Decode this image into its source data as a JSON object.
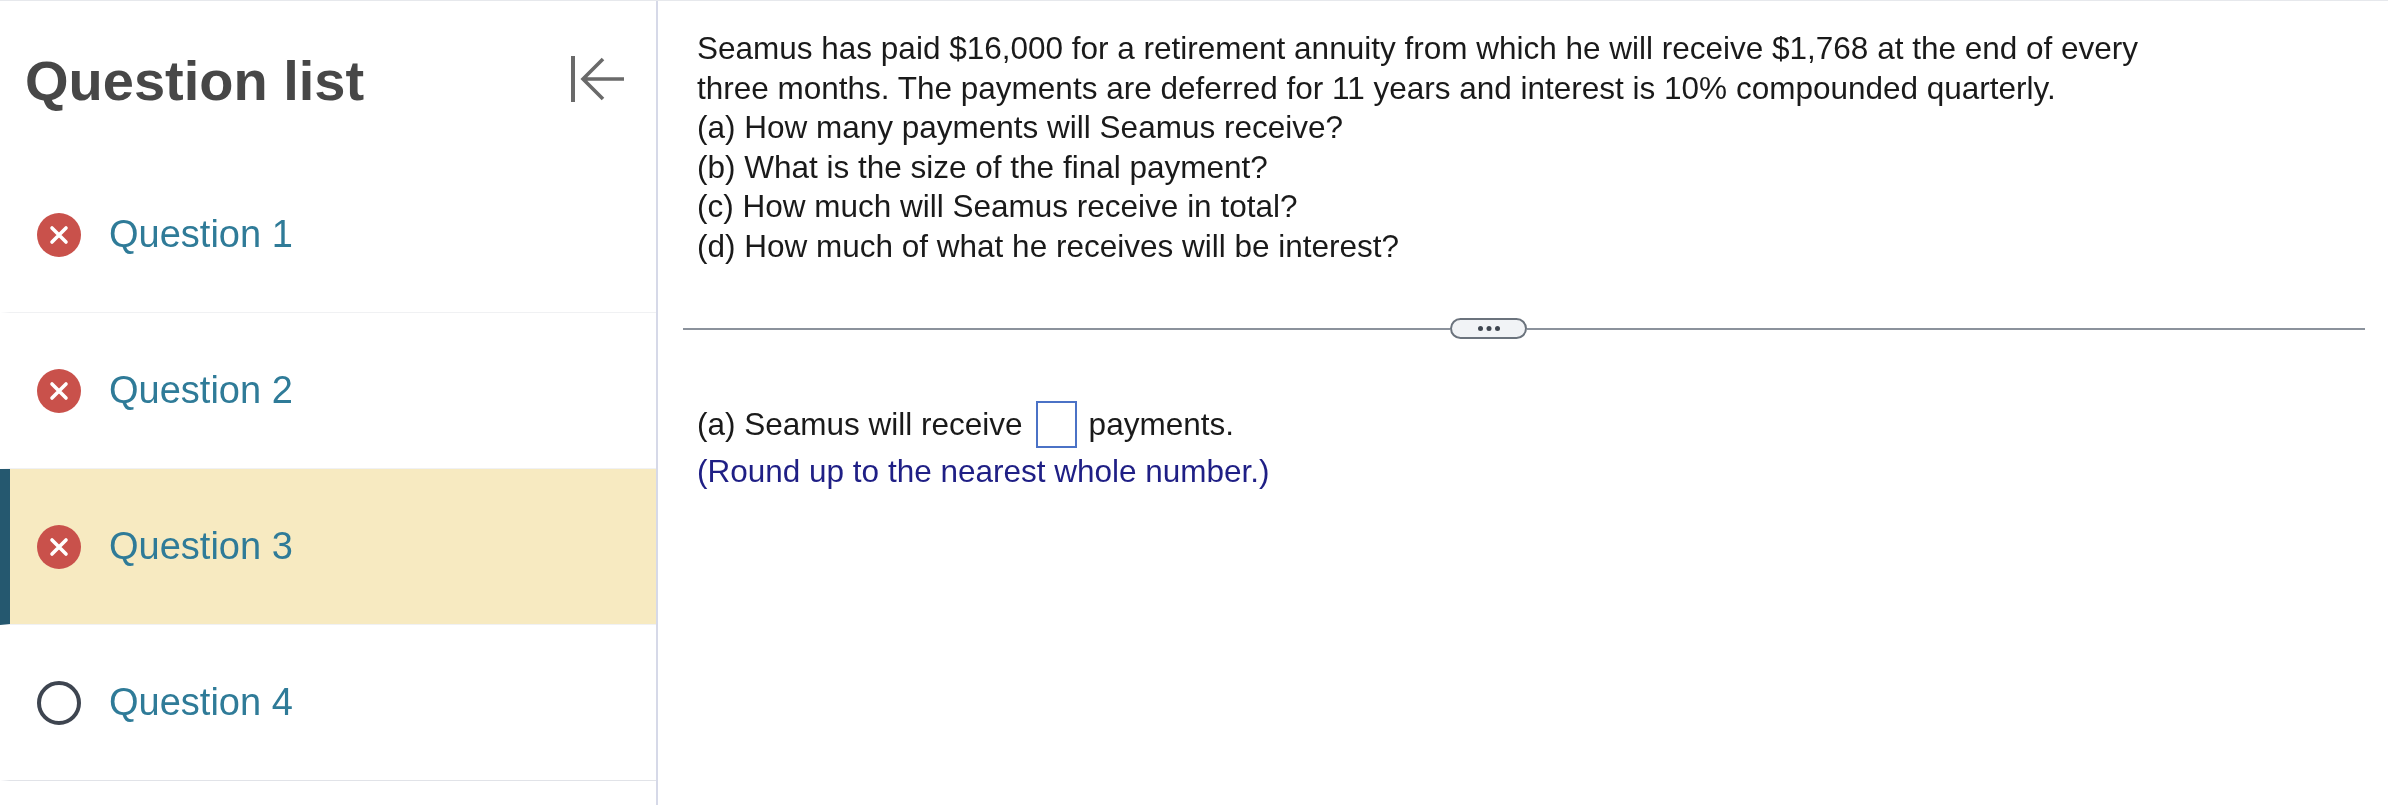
{
  "sidebar": {
    "title": "Question list",
    "items": [
      {
        "label": "Question 1",
        "kind": "incorrect",
        "selected": false
      },
      {
        "label": "Question 2",
        "kind": "incorrect",
        "selected": false
      },
      {
        "label": "Question 3",
        "kind": "incorrect",
        "selected": true
      },
      {
        "label": "Question 4",
        "kind": "unanswered",
        "selected": false
      }
    ]
  },
  "question": {
    "text": "Seamus has paid $16,000 for a retirement annuity from which he will receive $1,768 at the end of every three months. The payments are deferred for 11 years and interest is 10% compounded quarterly.",
    "parts": [
      "(a) How many payments will Seamus receive?",
      "(b) What is the size of the final payment?",
      "(c) How much will Seamus receive in total?",
      "(d) How much of what he receives will be interest?"
    ]
  },
  "answer": {
    "prompt": "(a) Seamus will receive",
    "unit": "payments.",
    "hint": "(Round up to the nearest whole number.)"
  }
}
